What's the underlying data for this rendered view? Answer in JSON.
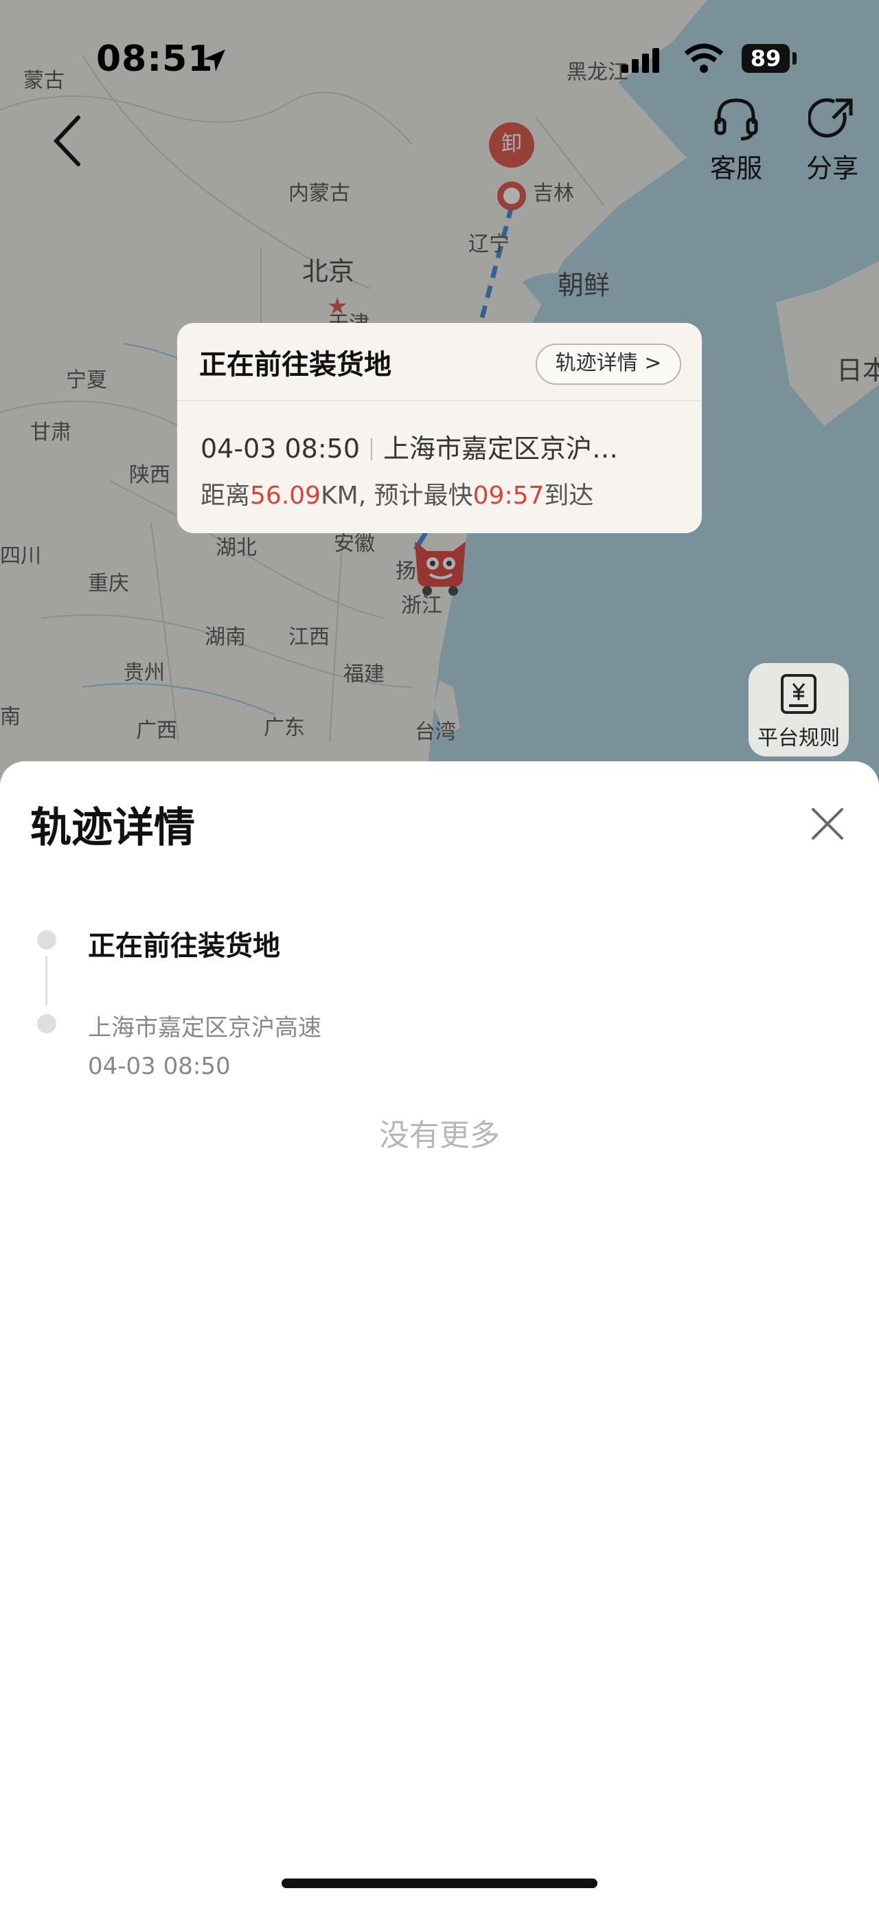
{
  "status_bar": {
    "time": "08:51",
    "battery": "89"
  },
  "map": {
    "labels": {
      "mongolia": "蒙古",
      "heilongjiang": "黑龙江",
      "neimenggu": "内蒙古",
      "jilin": "吉林",
      "liaoning": "辽宁",
      "beijing": "北京",
      "tianjin": "天津",
      "korea": "朝鲜",
      "ningxia": "宁夏",
      "japan": "日本",
      "gansu": "甘肃",
      "shaanxi": "陕西",
      "sichuan": "四川",
      "hubei": "湖北",
      "anhui": "安徽",
      "chongqing": "重庆",
      "yang": "扬",
      "zhejiang": "浙江",
      "hunan": "湖南",
      "jiangxi": "江西",
      "guizhou": "贵州",
      "fujian": "福建",
      "nan": "南",
      "guangxi": "广西",
      "guangdong": "广东",
      "taiwan": "台湾"
    },
    "unload_marker": "卸"
  },
  "header": {
    "service_label": "客服",
    "share_label": "分享"
  },
  "card": {
    "title": "正在前往装货地",
    "detail_button": "轨迹详情 >",
    "timestamp": "04-03 08:50",
    "location": "上海市嘉定区京沪…",
    "distance_prefix": "距离",
    "distance_value": "56.09",
    "distance_unit": "KM, 预计最快",
    "eta": "09:57",
    "eta_suffix": "到达"
  },
  "rules_button": {
    "label": "平台规则"
  },
  "sheet": {
    "title": "轨迹详情",
    "timeline": [
      {
        "status": "正在前往装货地"
      },
      {
        "location": "上海市嘉定区京沪高速",
        "time": "04-03 08:50"
      }
    ],
    "no_more": "没有更多"
  },
  "colors": {
    "accent_red": "#d9443a",
    "route_blue": "#2f7fd6",
    "sea": "#a8cfdf"
  }
}
